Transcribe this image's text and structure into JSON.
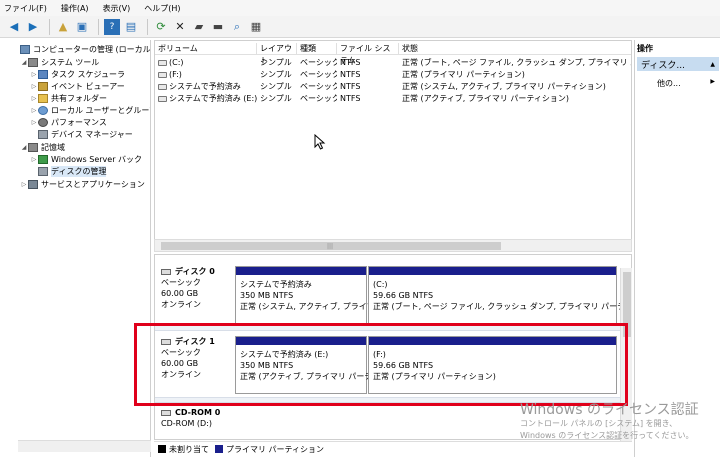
{
  "menu": [
    "ファイル(F)",
    "操作(A)",
    "表示(V)",
    "ヘルプ(H)"
  ],
  "tree": {
    "root": "コンピューターの管理 (ローカル)",
    "system_tools": "システム ツール",
    "task_scheduler": "タスク スケジューラ",
    "event_viewer": "イベント ビューアー",
    "shared_folders": "共有フォルダー",
    "local_users": "ローカル ユーザーとグループ",
    "performance": "パフォーマンス",
    "device_manager": "デバイス マネージャー",
    "storage": "記憶域",
    "windows_server_backup": "Windows Server バック",
    "disk_management": "ディスクの管理",
    "services_apps": "サービスとアプリケーション"
  },
  "volumes": {
    "headers": [
      "ボリューム",
      "レイアウト",
      "種類",
      "ファイル システム",
      "状態"
    ],
    "rows": [
      [
        "(C:)",
        "シンプル",
        "ベーシック",
        "NTFS",
        "正常 (ブート, ページ ファイル, クラッシュ ダンプ, プライマリ パーティション)"
      ],
      [
        "(F:)",
        "シンプル",
        "ベーシック",
        "NTFS",
        "正常 (プライマリ パーティション)"
      ],
      [
        "システムで予約済み",
        "シンプル",
        "ベーシック",
        "NTFS",
        "正常 (システム, アクティブ, プライマリ パーティション)"
      ],
      [
        "システムで予約済み (E:)",
        "シンプル",
        "ベーシック",
        "NTFS",
        "正常 (アクティブ, プライマリ パーティション)"
      ]
    ]
  },
  "disks": [
    {
      "name": "ディスク 0",
      "type": "ベーシック",
      "size": "60.00 GB",
      "status": "オンライン",
      "partitions": [
        {
          "name": "システムで予約済み",
          "size": "350 MB NTFS",
          "status": "正常 (システム, アクティブ, プライマリ"
        },
        {
          "name": "(C:)",
          "size": "59.66 GB NTFS",
          "status": "正常 (ブート, ページ ファイル, クラッシュ ダンプ, プライマリ パーティション)"
        }
      ]
    },
    {
      "name": "ディスク 1",
      "type": "ベーシック",
      "size": "60.00 GB",
      "status": "オンライン",
      "partitions": [
        {
          "name": "システムで予約済み (E:)",
          "size": "350 MB NTFS",
          "status": "正常 (アクティブ, プライマリ パーティシ"
        },
        {
          "name": "(F:)",
          "size": "59.66 GB NTFS",
          "status": "正常 (プライマリ パーティション)"
        }
      ]
    },
    {
      "name": "CD-ROM 0",
      "type": "CD-ROM (D:)"
    }
  ],
  "legend": {
    "unallocated": "未割り当て",
    "primary": "プライマリ パーティション"
  },
  "actions": {
    "header": "操作",
    "group": "ディスク...",
    "other": "他の..."
  },
  "watermark": {
    "title": "Windows のライセンス認証",
    "line1": "コントロール パネルの [システム] を開き、",
    "line2": "Windows のライセンス認証を行ってください。"
  },
  "colors": {
    "partition_bar": "#1a1f8c",
    "highlight": "#e0001b",
    "unallocated": "#000000",
    "primary": "#1a1f8c"
  }
}
